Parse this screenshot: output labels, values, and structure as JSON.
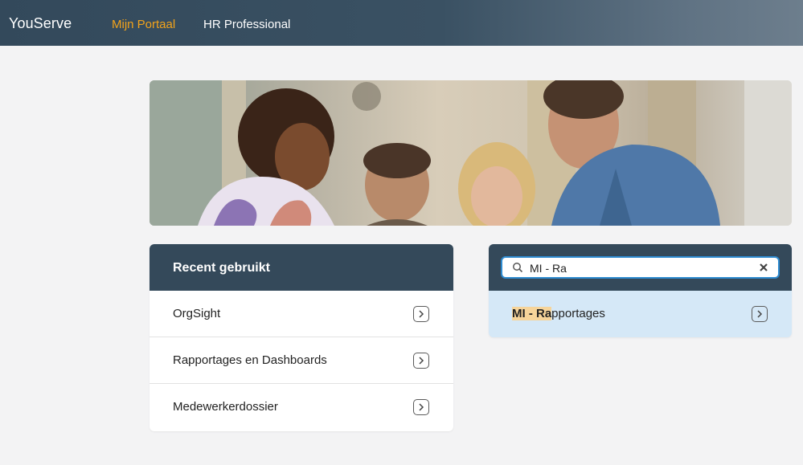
{
  "header": {
    "brand": "YouServe",
    "nav": [
      {
        "label": "Mijn Portaal",
        "active": true
      },
      {
        "label": "HR Professional",
        "active": false
      }
    ]
  },
  "recent": {
    "title": "Recent gebruikt",
    "items": [
      {
        "label": "OrgSight",
        "icon": "chevron-right-icon"
      },
      {
        "label": "Rapportages en Dashboards",
        "icon": "chevron-right-icon"
      },
      {
        "label": "Medewerkerdossier",
        "icon": "chevron-right-icon"
      }
    ]
  },
  "search": {
    "value": "MI - Ra",
    "results": [
      {
        "match": "MI - Ra",
        "rest": "pportages",
        "icon": "chevron-right-icon"
      }
    ]
  },
  "colors": {
    "header_bg": "#34495a",
    "accent_orange": "#f2a31b",
    "search_border": "#2e8bd0",
    "result_bg": "#d5e8f7",
    "highlight": "#f6d49a"
  }
}
